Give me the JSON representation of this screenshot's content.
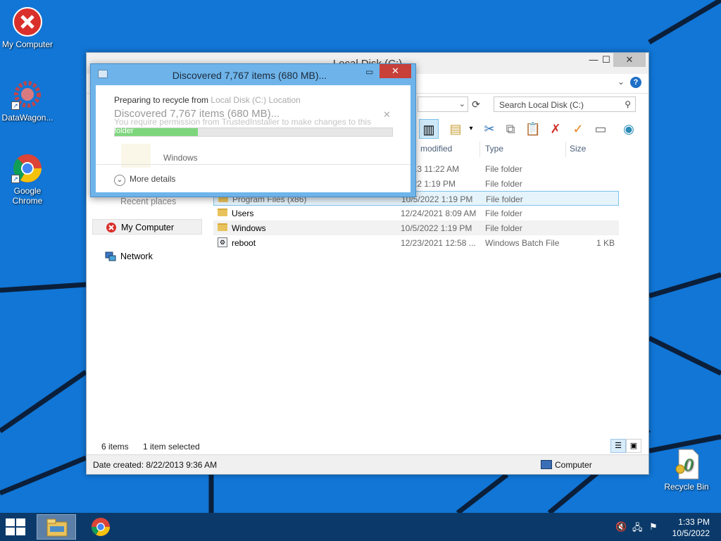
{
  "desktop": {
    "icons": [
      {
        "label": "My Computer",
        "icon": "error-x-icon"
      },
      {
        "label": "DataWagon...",
        "icon": "gear-icon"
      },
      {
        "label": "Google Chrome",
        "icon": "chrome-icon"
      },
      {
        "label": "Recycle Bin",
        "icon": "certificate-icon"
      }
    ]
  },
  "explorer": {
    "title": "Local Disk (C:)",
    "search_placeholder": "Search Local Disk (C:)",
    "columns": [
      "modified",
      "Type",
      "Size"
    ],
    "nav": {
      "recent": "Recent places",
      "my_computer": "My Computer",
      "network": "Network"
    },
    "rows": [
      {
        "name": "",
        "date": "/2013 11:22 AM",
        "type": "File folder",
        "size": "",
        "kind": "folder"
      },
      {
        "name": "",
        "date": "/2022 1:19 PM",
        "type": "File folder",
        "size": "",
        "kind": "folder"
      },
      {
        "name": "Program Files (x86)",
        "date": "10/5/2022 1:19 PM",
        "type": "File folder",
        "size": "",
        "kind": "folder"
      },
      {
        "name": "Users",
        "date": "12/24/2021 8:09 AM",
        "type": "File folder",
        "size": "",
        "kind": "folder"
      },
      {
        "name": "Windows",
        "date": "10/5/2022 1:19 PM",
        "type": "File folder",
        "size": "",
        "kind": "folder"
      },
      {
        "name": "reboot",
        "date": "12/23/2021 12:58 ...",
        "type": "Windows Batch File",
        "size": "1 KB",
        "kind": "bat"
      }
    ],
    "status": {
      "items": "6 items",
      "selected": "1 item selected",
      "date_created": "Date created: 8/22/2013 9:36 AM",
      "location": "Computer"
    }
  },
  "dialog": {
    "title": "Discovered 7,767 items (680 MB)...",
    "preparing": "Preparing to recycle from",
    "source": "Local Disk (C:)",
    "faint_extra": "Location",
    "discovered": "Discovered 7,767 items (680 MB)...",
    "permission": "You require permission from TrustedInstaller to make changes to this",
    "folder_word": "folder",
    "progress": 0.3,
    "item_name": "Windows",
    "more_details": "More details"
  },
  "taskbar": {
    "time": "1:33 PM",
    "date": "10/5/2022"
  },
  "colors": {
    "desktop": "#1176d6",
    "dialog_frame": "#6eb4ea",
    "progress": "#7dd67c",
    "close_red": "#c7403a"
  }
}
